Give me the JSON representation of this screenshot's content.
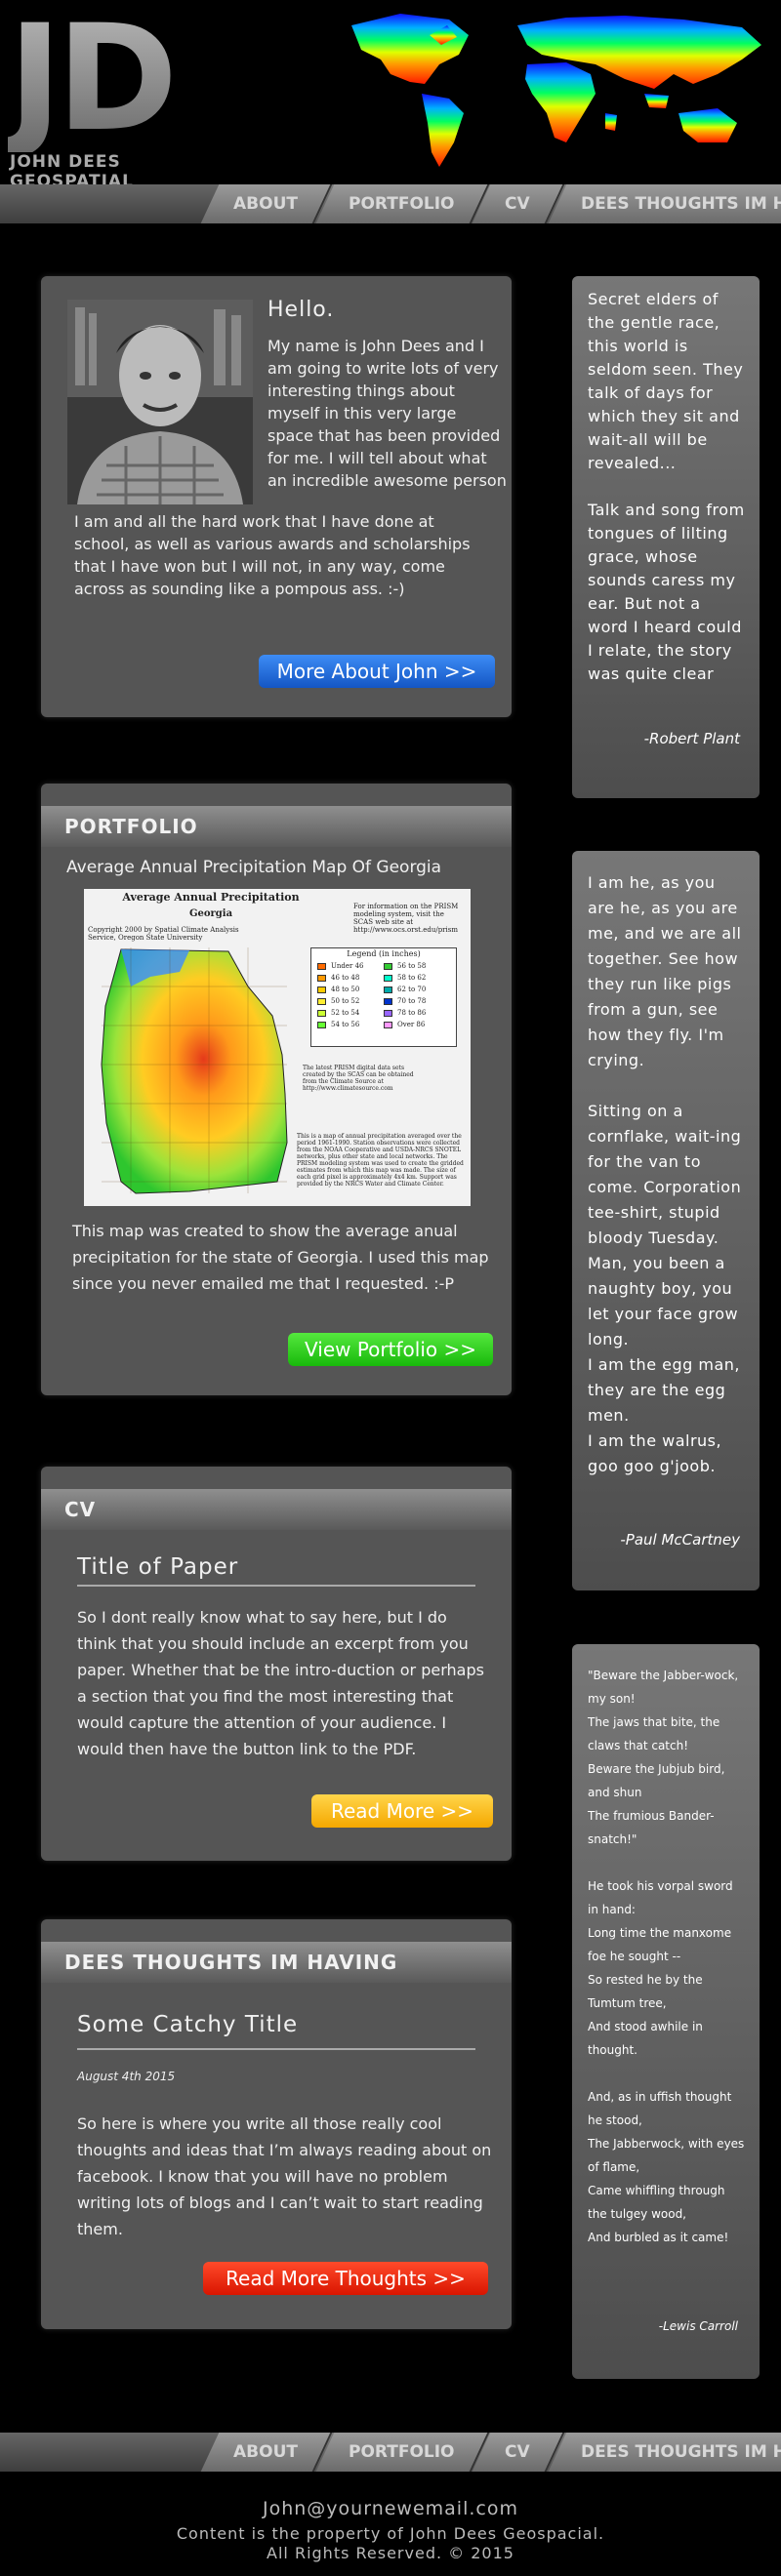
{
  "brand": {
    "initials": "JD",
    "name": "JOHN DEES GEOSPATIAL"
  },
  "nav": {
    "items": [
      "ABOUT",
      "PORTFOLIO",
      "CV",
      "DEES THOUGHTS IM HAVING"
    ]
  },
  "about": {
    "greeting": "Hello.",
    "intro": "My name is John Dees and I am going to write lots of very interesting things about myself in this very large space that has been provided for me. I will tell about what an incredible awesome person",
    "intro_cont": "I am and all the hard work that I have done at school, as well as various awards and scholarships that I have won but I will not, in any way, come across as sounding like a pompous ass. :-)",
    "button": "More About John >>"
  },
  "portfolio": {
    "heading": "PORTFOLIO",
    "map_title": "Average Annual Precipitation Map Of Georgia",
    "map_inner_title": "Average Annual Precipitation",
    "map_inner_sub": "Georgia",
    "map_copyright": "Copyright 2000 by Spatial Climate Analysis Service, Oregon State University",
    "map_info": "For information on the PRISM modeling system, visit the SCAS web site at http://www.ocs.orst.edu/prism",
    "legend_title": "Legend (in inches)",
    "legend": [
      {
        "label": "Under 46",
        "color": "#ff6a00"
      },
      {
        "label": "56 to 58",
        "color": "#33cc33"
      },
      {
        "label": "46 to 48",
        "color": "#ff9900"
      },
      {
        "label": "58 to 62",
        "color": "#00ffcc"
      },
      {
        "label": "48 to 50",
        "color": "#ffcc00"
      },
      {
        "label": "62 to 70",
        "color": "#00aaaa"
      },
      {
        "label": "50 to 52",
        "color": "#ffee33"
      },
      {
        "label": "70 to 78",
        "color": "#0033cc"
      },
      {
        "label": "52 to 54",
        "color": "#ccff33"
      },
      {
        "label": "78 to 86",
        "color": "#9966ff"
      },
      {
        "label": "54 to 56",
        "color": "#66ff33"
      },
      {
        "label": "Over 86",
        "color": "#ff99ff"
      }
    ],
    "map_note1": "The latest PRISM digital data sets created by the SCAS can be obtained from the Climate Source at http://www.climatesource.com",
    "map_note2": "This is a map of annual precipitation averaged over the period 1961-1990. Station observations were collected from the NOAA Cooperative and USDA-NRCS SNOTEL networks, plus other state and local networks. The PRISM modeling system was used to create the gridded estimates from which this map was made. The size of each grid pixel is approximately 4x4 km. Support was provided by the NRCS Water and Climate Center.",
    "description": "This map was created to show the average anual precipitation for the state of Georgia. I used this map since you never emailed me that I requested.  :-P",
    "button": "View Portfolio  >>"
  },
  "cv": {
    "heading": "CV",
    "paper_title": "Title of Paper",
    "excerpt": "So I dont really know what to say here, but I do think that you should include an excerpt from you paper. Whether that be the intro-duction or perhaps a section that you find the most interesting that would capture the attention of your audience. I would then have the button link to the PDF.",
    "button": "Read More >>"
  },
  "thoughts": {
    "heading": "DEES THOUGHTS IM HAVING",
    "post_title": "Some Catchy Title",
    "date": "August 4th 2015",
    "body": "So here is where you write all those really cool thoughts and ideas that I’m always reading about on facebook. I know that you will have no problem writing lots of blogs and I can’t wait to start reading them.",
    "button": "Read More Thoughts >>"
  },
  "quotes": [
    {
      "text": "Secret elders of the gentle race, this world is seldom seen. They talk of days for which they sit and wait-all will be revealed...\n\nTalk and song from tongues of lilting grace, whose sounds caress my ear. But not a word I heard could I relate, the story was quite clear",
      "author": "-Robert Plant"
    },
    {
      "text": "I am he, as you are he, as you are me, and we are all together. See how they run like pigs from a gun, see how they fly. I'm crying.\n\nSitting on a cornflake, wait-ing for the van to come. Corporation tee-shirt, stupid bloody Tuesday. Man, you been a naughty boy, you let your face grow long.\nI am the egg man,\nthey are the egg men.\nI am the walrus, goo goo g'joob.",
      "author": "-Paul McCartney"
    },
    {
      "text": "\"Beware the Jabber-wock, my son!\n The jaws that bite, the claws that catch!\nBeware the Jubjub bird, and shun\n The frumious Bander-snatch!\"\n\nHe took his vorpal sword in hand:\n Long time the manxome foe he sought --\nSo rested he by the Tumtum tree,\n And stood awhile in thought.\n\nAnd, as in uffish thought he stood,\n The Jabberwock, with eyes of flame,\nCame whiffling through the tulgey wood,\n And burbled as it came!",
      "author": "-Lewis Carroll"
    }
  ],
  "footer": {
    "email": "John@yournewemail.com",
    "line1": "Content is the property of John Dees Geospacial.",
    "line2": "All Rights Reserved. ©  2015"
  },
  "colors": {
    "blue_button": "#1c6fe0",
    "green_button": "#2ecc1a",
    "yellow_button": "#ffc20e",
    "red_button": "#e8210f"
  }
}
